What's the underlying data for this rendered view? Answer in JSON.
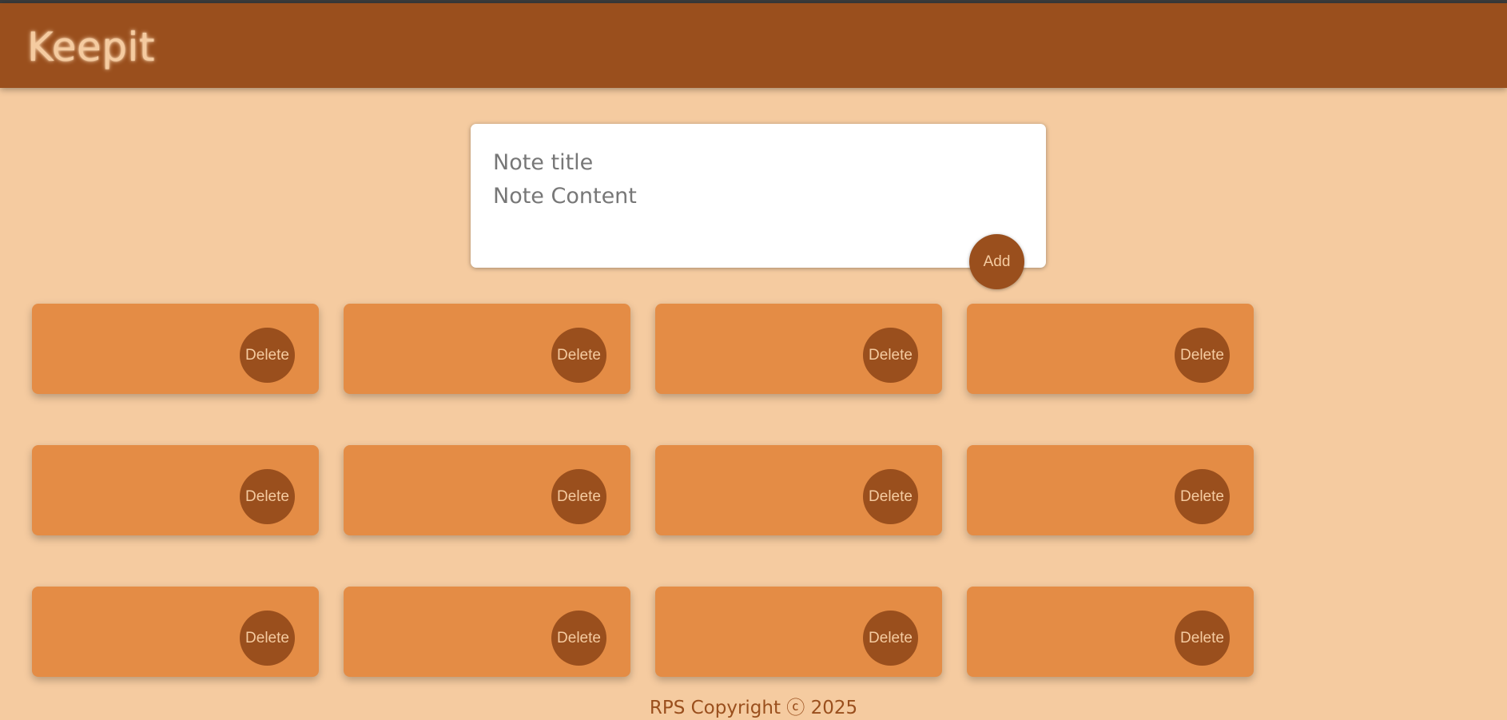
{
  "header": {
    "title": "Keepit"
  },
  "composer": {
    "title_placeholder": "Note title",
    "content_placeholder": "Note Content",
    "add_label": "Add"
  },
  "notes": [
    {
      "title": "",
      "content": "",
      "delete_label": "Delete"
    },
    {
      "title": "",
      "content": "",
      "delete_label": "Delete"
    },
    {
      "title": "",
      "content": "",
      "delete_label": "Delete"
    },
    {
      "title": "",
      "content": "",
      "delete_label": "Delete"
    },
    {
      "title": "",
      "content": "",
      "delete_label": "Delete"
    },
    {
      "title": "",
      "content": "",
      "delete_label": "Delete"
    },
    {
      "title": "",
      "content": "",
      "delete_label": "Delete"
    },
    {
      "title": "",
      "content": "",
      "delete_label": "Delete"
    },
    {
      "title": "",
      "content": "",
      "delete_label": "Delete"
    },
    {
      "title": "",
      "content": "",
      "delete_label": "Delete"
    },
    {
      "title": "",
      "content": "",
      "delete_label": "Delete"
    },
    {
      "title": "",
      "content": "",
      "delete_label": "Delete"
    }
  ],
  "footer": {
    "text": "RPS Copyright ⓒ 2025"
  },
  "colors": {
    "background": "#f5cba0",
    "header": "#9a4f1d",
    "note": "#e48c45",
    "button": "#9a4f1d",
    "button_text": "#f5cba0"
  }
}
